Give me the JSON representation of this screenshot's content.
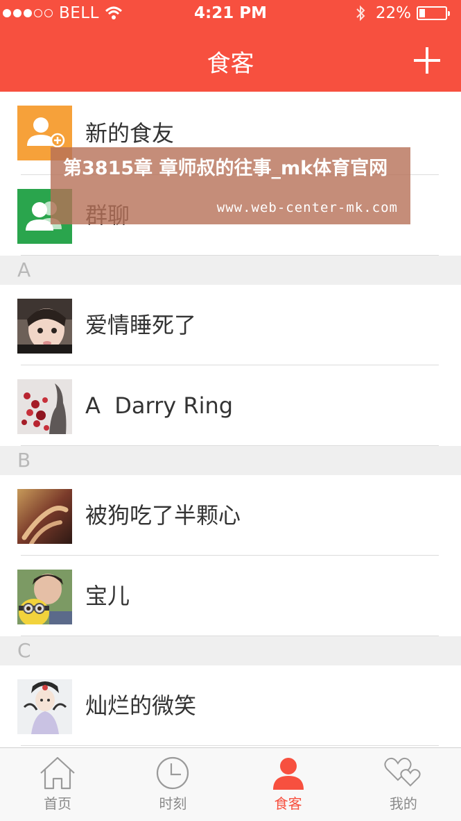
{
  "status_bar": {
    "carrier": "BELL",
    "time": "4:21 PM",
    "battery": "22%",
    "signal_bars_filled": 3,
    "signal_bars_total": 5
  },
  "header": {
    "title": "食客"
  },
  "top_items": [
    {
      "label": "新的食友",
      "icon": "add-friend-icon"
    },
    {
      "label": "群聊",
      "icon": "group-chat-icon"
    }
  ],
  "sections": [
    {
      "letter": "A",
      "contacts": [
        {
          "name": "爱情睡死了"
        },
        {
          "name": "A  Darry Ring"
        }
      ]
    },
    {
      "letter": "B",
      "contacts": [
        {
          "name": "被狗吃了半颗心"
        },
        {
          "name": "宝儿"
        }
      ]
    },
    {
      "letter": "C",
      "contacts": [
        {
          "name": "灿烂的微笑"
        }
      ]
    }
  ],
  "banner": {
    "title": "第3815章 章师叔的往事_mk体育官网",
    "url": "www.web-center-mk.com"
  },
  "tabs": [
    {
      "label": "首页",
      "icon": "home-icon",
      "active": false
    },
    {
      "label": "时刻",
      "icon": "clock-icon",
      "active": false
    },
    {
      "label": "食客",
      "icon": "person-icon",
      "active": true
    },
    {
      "label": "我的",
      "icon": "hearts-icon",
      "active": false
    }
  ],
  "colors": {
    "accent": "#f7503f",
    "add_friend_bg": "#f6a13a",
    "group_chat_bg": "#2aa54d"
  }
}
